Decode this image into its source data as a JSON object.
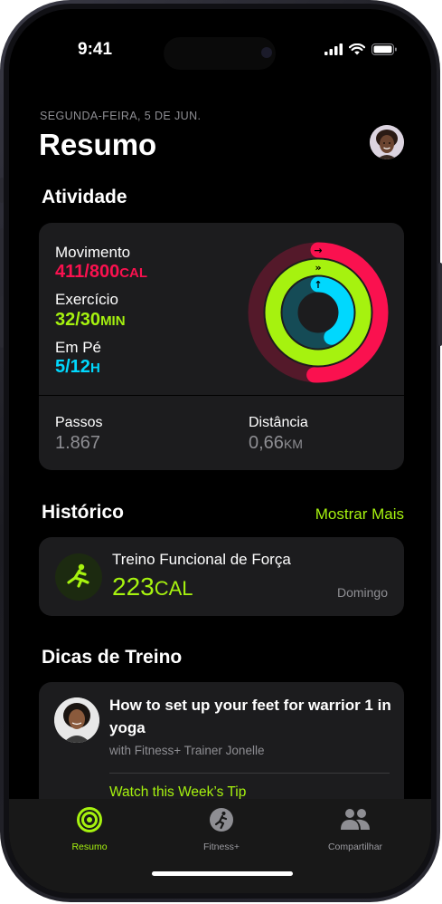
{
  "status": {
    "time": "9:41"
  },
  "header": {
    "date": "SEGUNDA-FEIRA, 5 DE JUN.",
    "title": "Resumo"
  },
  "activity": {
    "section_title": "Atividade",
    "move": {
      "label": "Movimento",
      "value": "411/800",
      "unit": "CAL",
      "color": "#fa114f",
      "progress": 0.51
    },
    "exercise": {
      "label": "Exercício",
      "value": "32/30",
      "unit": "MIN",
      "color": "#a6f20f",
      "progress": 1.07
    },
    "stand": {
      "label": "Em Pé",
      "value": "5/12",
      "unit": "H",
      "color": "#00d8fe",
      "progress": 0.42
    },
    "steps": {
      "label": "Passos",
      "value": "1.867"
    },
    "distance": {
      "label": "Distância",
      "value": "0,66",
      "unit": "KM"
    }
  },
  "history": {
    "section_title": "Histórico",
    "more_label": "Mostrar Mais",
    "workout": {
      "title": "Treino Funcional de Força",
      "value": "223",
      "unit": "CAL",
      "day": "Domingo",
      "icon": "functional-strength-icon"
    }
  },
  "tips": {
    "section_title": "Dicas de Treino",
    "title": "How to set up your feet for warrior 1 in yoga",
    "subtitle": "with Fitness+ Trainer Jonelle",
    "link": "Watch this Week’s Tip"
  },
  "tabs": [
    {
      "label": "Resumo",
      "icon": "activity-rings-icon",
      "active": true
    },
    {
      "label": "Fitness+",
      "icon": "fitness-plus-icon",
      "active": false
    },
    {
      "label": "Compartilhar",
      "icon": "sharing-icon",
      "active": false
    }
  ],
  "colors": {
    "accent": "#a6f20f",
    "background": "#000000",
    "card": "#1c1c1e"
  }
}
